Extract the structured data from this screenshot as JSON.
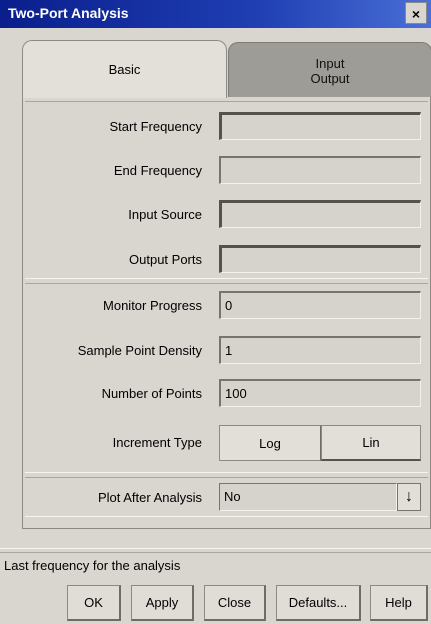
{
  "window": {
    "title": "Two-Port Analysis",
    "close_glyph": "×"
  },
  "tabs": [
    {
      "label": "Basic",
      "active": true
    },
    {
      "label_line1": "Input",
      "label_line2": "Output",
      "active": false
    }
  ],
  "fields": {
    "start_frequency": {
      "label": "Start Frequency",
      "value": ""
    },
    "end_frequency": {
      "label": "End Frequency",
      "value": ""
    },
    "input_source": {
      "label": "Input Source",
      "value": ""
    },
    "output_ports": {
      "label": "Output Ports",
      "value": ""
    },
    "monitor_progress": {
      "label": "Monitor Progress",
      "value": "0"
    },
    "sample_point_density": {
      "label": "Sample Point Density",
      "value": "1"
    },
    "number_of_points": {
      "label": "Number of Points",
      "value": "100"
    }
  },
  "increment_type": {
    "label": "Increment Type",
    "options": [
      "Log",
      "Lin"
    ],
    "selected": "Log"
  },
  "plot_after_analysis": {
    "label": "Plot After Analysis",
    "value": "No",
    "arrow_glyph": "↓"
  },
  "status_text": "Last frequency for the analysis",
  "buttons": {
    "ok": "OK",
    "apply": "Apply",
    "close": "Close",
    "defaults": "Defaults...",
    "help": "Help"
  }
}
